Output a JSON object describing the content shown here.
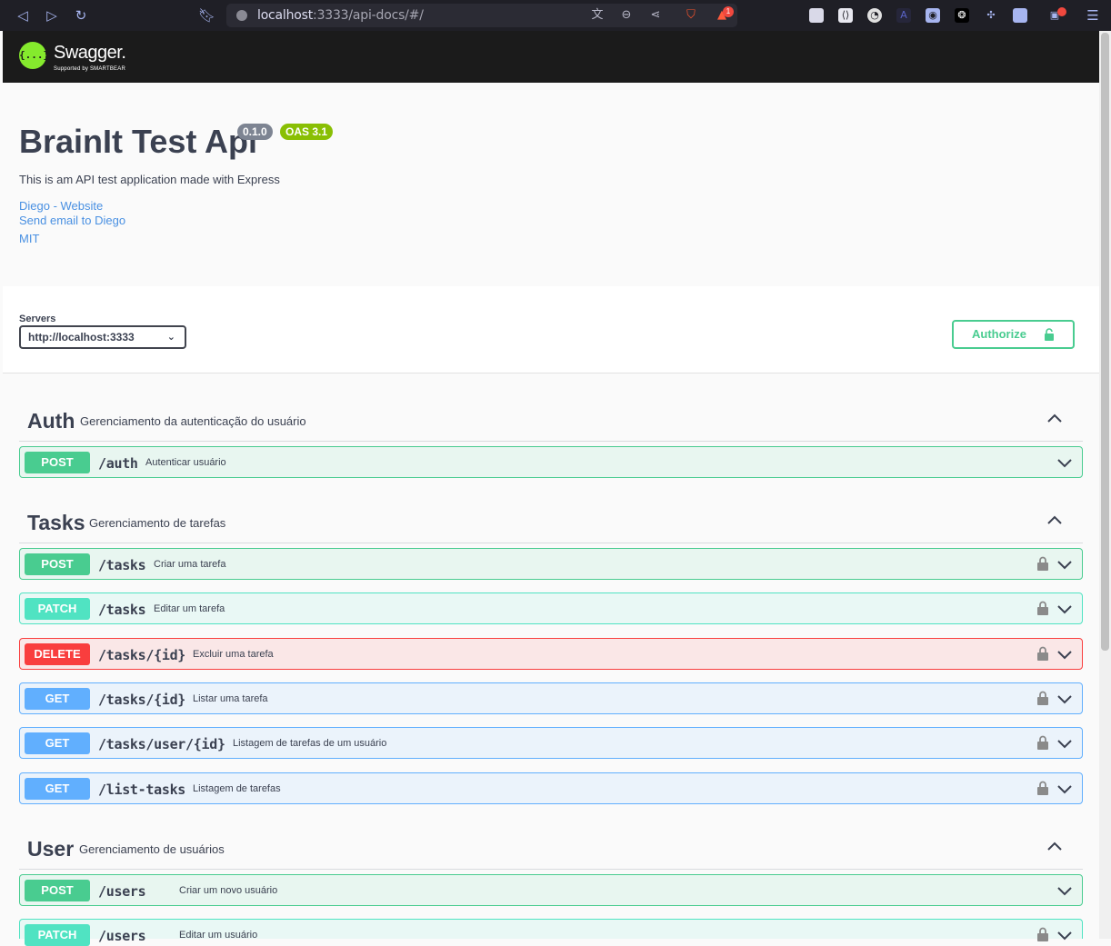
{
  "browser": {
    "url_host": "localhost",
    "url_rest": ":3333/api-docs/#/",
    "notification_count": "1"
  },
  "swagger": {
    "logo_text": "Swagger.",
    "logo_sub": "Supported by SMARTBEAR",
    "logo_glyph": "{...}"
  },
  "info": {
    "title": "BrainIt Test Api",
    "version": "0.1.0",
    "oas": "OAS 3.1",
    "description": "This is am API test application made with Express",
    "links": [
      "Diego - Website",
      "Send email to Diego",
      "MIT"
    ]
  },
  "scheme": {
    "servers_label": "Servers",
    "selected_server": "http://localhost:3333",
    "authorize_label": "Authorize"
  },
  "tags": [
    {
      "name": "Auth",
      "description": "Gerenciamento da autenticação do usuário",
      "operations": [
        {
          "method": "POST",
          "path": "/auth",
          "summary": "Autenticar usuário",
          "locked": false
        }
      ]
    },
    {
      "name": "Tasks",
      "description": "Gerenciamento de tarefas",
      "operations": [
        {
          "method": "POST",
          "path": "/tasks",
          "summary": "Criar uma tarefa",
          "locked": true
        },
        {
          "method": "PATCH",
          "path": "/tasks",
          "summary": "Editar um tarefa",
          "locked": true
        },
        {
          "method": "DELETE",
          "path": "/tasks/{id}",
          "summary": "Excluir uma tarefa",
          "locked": true
        },
        {
          "method": "GET",
          "path": "/tasks/{id}",
          "summary": "Listar uma tarefa",
          "locked": true
        },
        {
          "method": "GET",
          "path": "/tasks/user/{id}",
          "summary": "Listagem de tarefas de um usuário",
          "locked": true
        },
        {
          "method": "GET",
          "path": "/list-tasks",
          "summary": "Listagem de tarefas",
          "locked": true
        }
      ]
    },
    {
      "name": "User",
      "description": "Gerenciamento de usuários",
      "operations": [
        {
          "method": "POST",
          "path": "/users",
          "summary": "Criar um novo usuário",
          "locked": false
        },
        {
          "method": "PATCH",
          "path": "/users",
          "summary": "Editar um usuário",
          "locked": true
        }
      ]
    }
  ],
  "colors": {
    "post": "#49cc90",
    "patch": "#50e3c2",
    "delete": "#f93e3e",
    "get": "#61affe",
    "swagger_green": "#85ea2d"
  }
}
